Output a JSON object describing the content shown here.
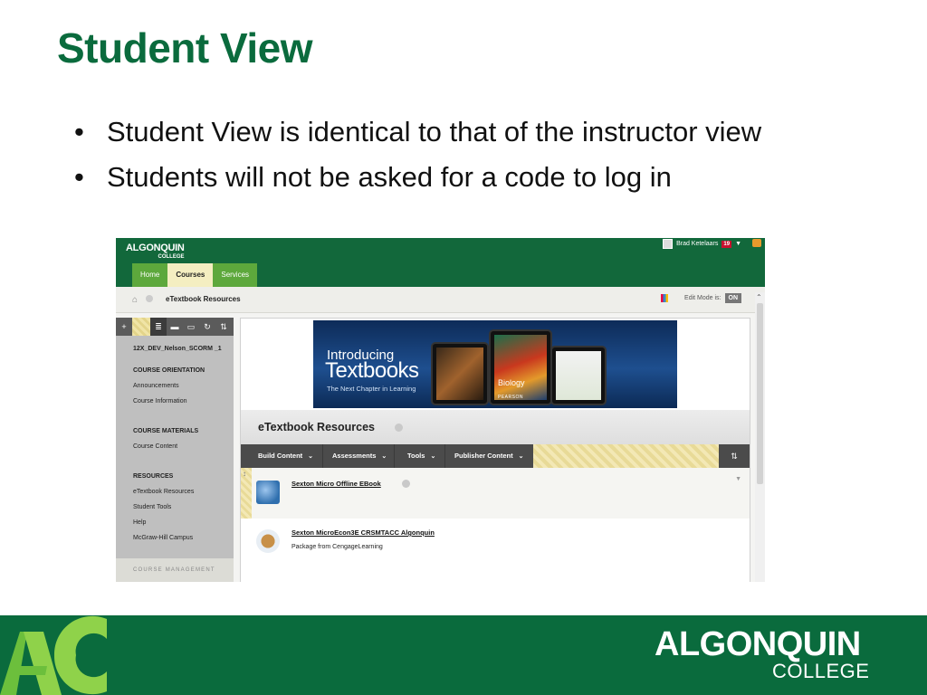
{
  "slide": {
    "title": "Student View",
    "bullets": [
      "Student View is identical to that of the instructor view",
      "Students will not be asked for a code to log in"
    ],
    "bullet_symbol": "•"
  },
  "screenshot": {
    "logo": {
      "line1": "ALGONQUIN",
      "line2": "COLLEGE"
    },
    "user": {
      "name": "Brad Ketelaars",
      "notifications": "19"
    },
    "tabs": [
      {
        "label": "Home",
        "active": false
      },
      {
        "label": "Courses",
        "active": true
      },
      {
        "label": "Services",
        "active": false
      }
    ],
    "breadcrumb": "eTextbook Resources",
    "edit_mode": {
      "label": "Edit Mode is:",
      "value": "ON"
    },
    "sidebar": {
      "course_id": "12X_DEV_Nelson_SCORM _1",
      "sections": [
        {
          "heading": "COURSE ORIENTATION",
          "items": [
            "Announcements",
            "Course Information"
          ]
        },
        {
          "heading": "COURSE MATERIALS",
          "items": [
            "Course Content"
          ]
        },
        {
          "heading": "RESOURCES",
          "items": [
            "eTextbook Resources",
            "Student Tools",
            "Help",
            "McGraw-Hill Campus"
          ]
        }
      ],
      "management": "COURSE MANAGEMENT"
    },
    "banner": {
      "line1": "Introducing",
      "line2": "Textbooks",
      "line3": "The Next Chapter in Learning",
      "book_title": "Biology",
      "publisher": "PEARSON"
    },
    "page_title": "eTextbook Resources",
    "actions": [
      "Build Content",
      "Assessments",
      "Tools",
      "Publisher Content"
    ],
    "items": [
      {
        "title": "Sexton Micro Offline EBook",
        "subtitle": ""
      },
      {
        "title": "Sexton MicroEcon3E CRSMTACC Algonquin",
        "subtitle": "Package from CengageLearning"
      }
    ]
  },
  "footer": {
    "line1": "ALGONQUIN",
    "line2": "COLLEGE"
  },
  "colors": {
    "brand_green": "#0a6b3d",
    "tab_green": "#5da83c",
    "active_tab": "#f4eec1"
  }
}
